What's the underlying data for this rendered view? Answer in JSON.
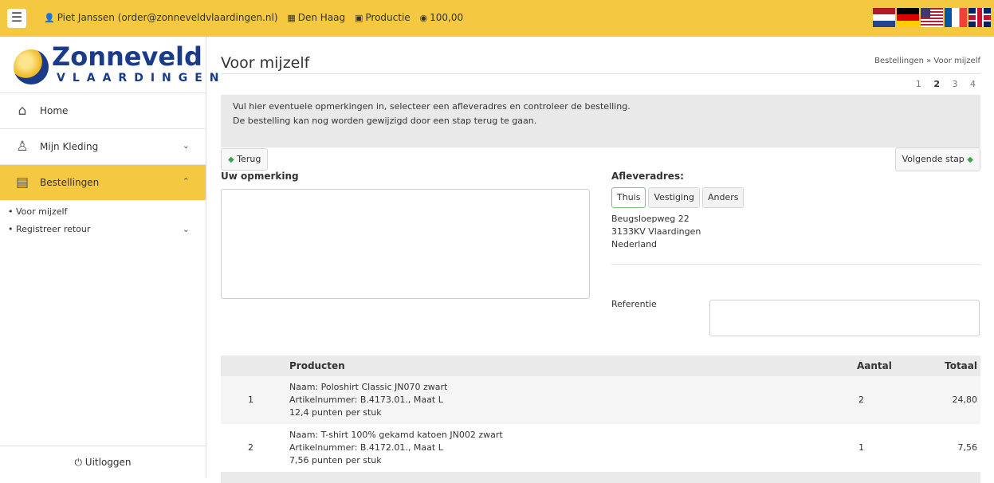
{
  "topbar": {
    "user": "Piet Janssen (order@zonneveldvlaardingen.nl)",
    "location": "Den Haag",
    "environment": "Productie",
    "points": "100,00",
    "languages": [
      "nl",
      "de",
      "en-us",
      "fr",
      "en-gb"
    ]
  },
  "logo": {
    "name": "Zonneveld",
    "sub": "VLAARDINGEN"
  },
  "sidebar": {
    "items": [
      {
        "label": "Home",
        "icon": "home-icon"
      },
      {
        "label": "Mijn Kleding",
        "icon": "user-icon"
      },
      {
        "label": "Bestellingen",
        "icon": "document-icon"
      }
    ],
    "subitems": [
      {
        "label": "• Voor mijzelf"
      },
      {
        "label": "• Registreer retour"
      }
    ],
    "logout": "Uitloggen"
  },
  "main": {
    "title": "Voor mijzelf",
    "breadcrumb": "Bestellingen » Voor mijzelf",
    "steps": [
      "1",
      "2",
      "3",
      "4"
    ],
    "current_step": "2",
    "info_line1": "Vul hier eventuele opmerkingen in, selecteer een afleveradres en controleer de bestelling.",
    "info_line2": "De bestelling kan nog worden gewijzigd door een stap terug te gaan.",
    "back_label": "Terug",
    "next_label": "Volgende stap",
    "remark_label": "Uw opmerking",
    "remark_value": "",
    "address_label": "Afleveradres:",
    "address_tabs": [
      "Thuis",
      "Vestiging",
      "Anders"
    ],
    "selected_tab": "Thuis",
    "address": {
      "street": "Beugsloepweg 22",
      "city": "3133KV Vlaardingen",
      "country": "Nederland"
    },
    "reference_label": "Referentie",
    "reference_value": ""
  },
  "table": {
    "headers": {
      "products": "Producten",
      "quantity": "Aantal",
      "total": "Totaal"
    },
    "rows": [
      {
        "index": "1",
        "name": "Naam: Poloshirt Classic JN070 zwart",
        "article": "Artikelnummer: B.4173.01., Maat L",
        "points": "12,4 punten per stuk",
        "quantity": "2",
        "total": "24,80"
      },
      {
        "index": "2",
        "name": "Naam: T-shirt 100% gekamd katoen JN002 zwart",
        "article": "Artikelnummer: B.4172.01., Maat L",
        "points": "7,56 punten per stuk",
        "quantity": "1",
        "total": "7,56"
      }
    ]
  }
}
